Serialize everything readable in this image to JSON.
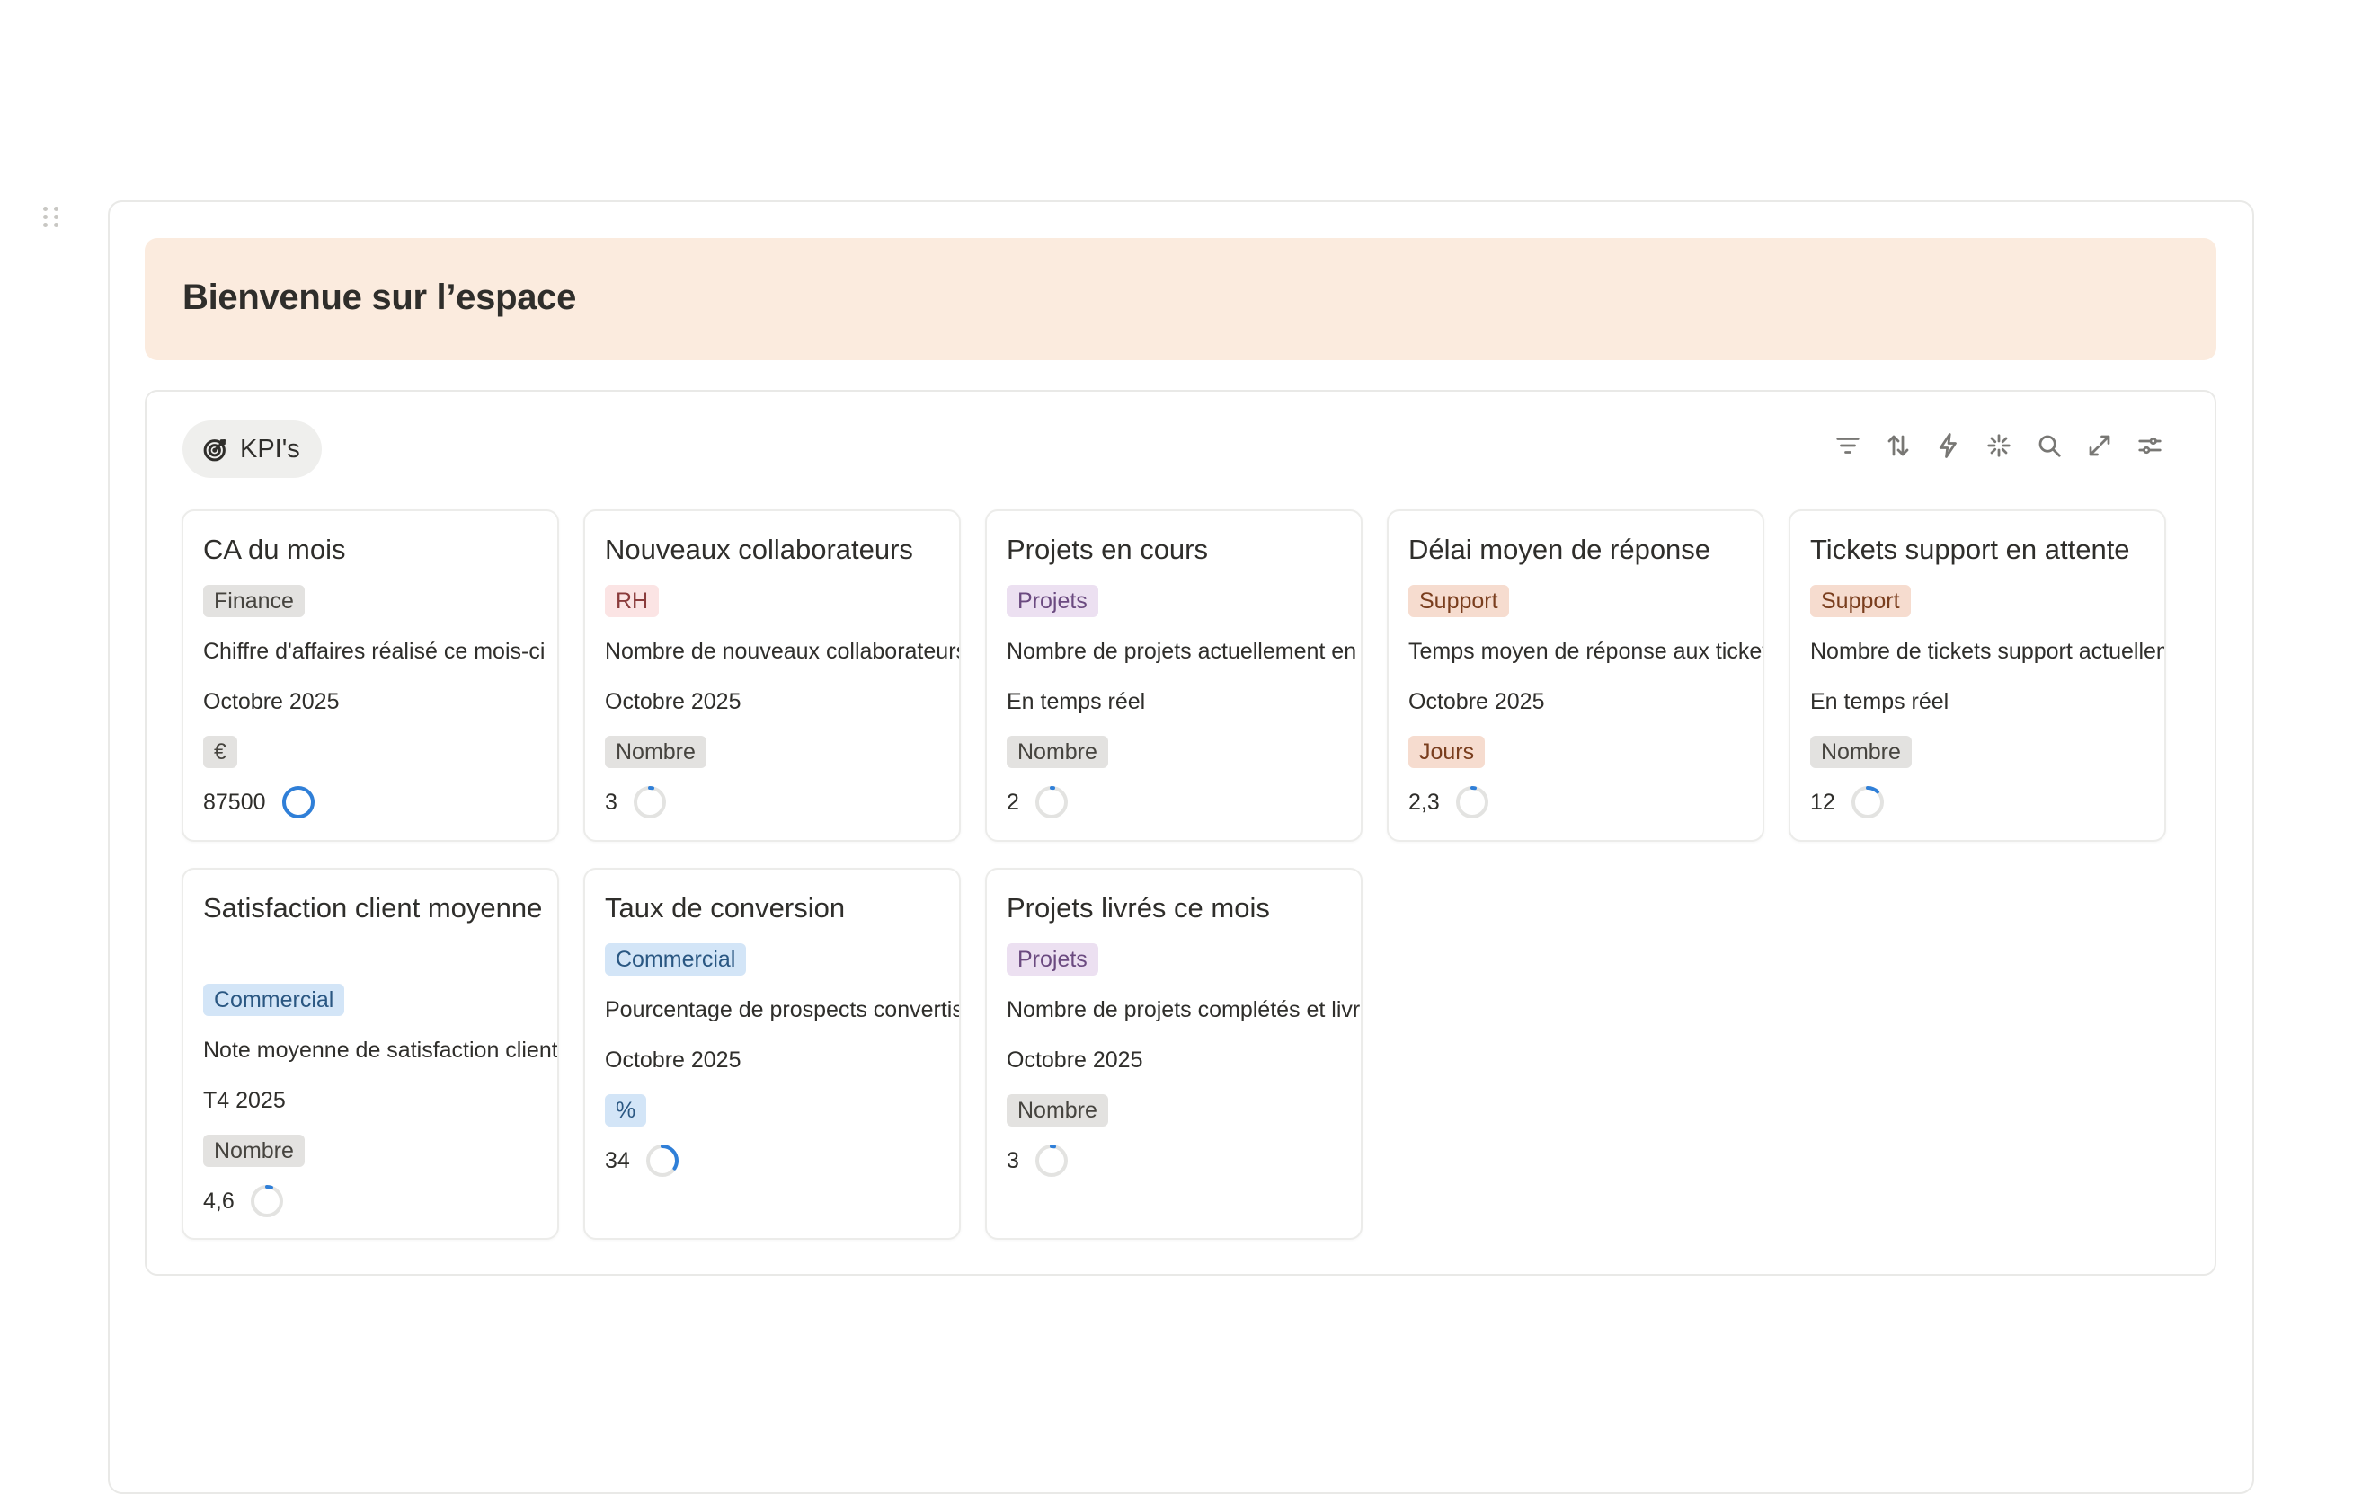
{
  "banner": {
    "title": "Bienvenue sur l’espace"
  },
  "database": {
    "tab_label": "KPI's",
    "tab_icon": "target-icon",
    "toolbar": [
      "filter-icon",
      "sort-icon",
      "automation-bolt-icon",
      "ai-sparkle-icon",
      "search-icon",
      "expand-icon",
      "settings-sliders-icon"
    ]
  },
  "colors": {
    "banner_bg": "#fbebde",
    "ring_track": "#e3e3e1",
    "ring_progress": "#2f7fd8",
    "tag_gray": "#e3e2e0",
    "tag_red": "#fbe4e4",
    "tag_purple": "#ece0f1",
    "tag_orange": "#f6dccf",
    "tag_blue": "#d3e5f7"
  },
  "cards": [
    {
      "title": "CA du mois",
      "category": "Finance",
      "category_color": "gray",
      "description": "Chiffre d'affaires réalisé ce mois-ci",
      "period": "Octobre 2025",
      "unit": "€",
      "unit_color": "gray",
      "value": "87500",
      "progress": 1.0
    },
    {
      "title": "Nouveaux collaborateurs",
      "category": "RH",
      "category_color": "red",
      "description": "Nombre de nouveaux collaborateurs",
      "period": "Octobre 2025",
      "unit": "Nombre",
      "unit_color": "gray",
      "value": "3",
      "progress": 0.03
    },
    {
      "title": "Projets en cours",
      "category": "Projets",
      "category_color": "purple",
      "description": "Nombre de projets actuellement en cours",
      "period": "En temps réel",
      "unit": "Nombre",
      "unit_color": "gray",
      "value": "2",
      "progress": 0.02
    },
    {
      "title": "Délai moyen de réponse",
      "category": "Support",
      "category_color": "orange",
      "description": "Temps moyen de réponse aux tickets",
      "period": "Octobre 2025",
      "unit": "Jours",
      "unit_color": "orange",
      "value": "2,3",
      "progress": 0.03
    },
    {
      "title": "Tickets support en attente",
      "category": "Support",
      "category_color": "orange",
      "description": "Nombre de tickets support actuellement en attente",
      "period": "En temps réel",
      "unit": "Nombre",
      "unit_color": "gray",
      "value": "12",
      "progress": 0.12
    },
    {
      "title": "Satisfaction client moyenne",
      "category": "Commercial",
      "category_color": "blue",
      "description": "Note moyenne de satisfaction client",
      "period": "T4 2025",
      "unit": "Nombre",
      "unit_color": "gray",
      "value": "4,6",
      "progress": 0.05
    },
    {
      "title": "Taux de conversion",
      "category": "Commercial",
      "category_color": "blue",
      "description": "Pourcentage de prospects convertis",
      "period": "Octobre 2025",
      "unit": "%",
      "unit_color": "blue",
      "value": "34",
      "progress": 0.34
    },
    {
      "title": "Projets livrés ce mois",
      "category": "Projets",
      "category_color": "purple",
      "description": "Nombre de projets complétés et livrés",
      "period": "Octobre 2025",
      "unit": "Nombre",
      "unit_color": "gray",
      "value": "3",
      "progress": 0.03
    }
  ]
}
